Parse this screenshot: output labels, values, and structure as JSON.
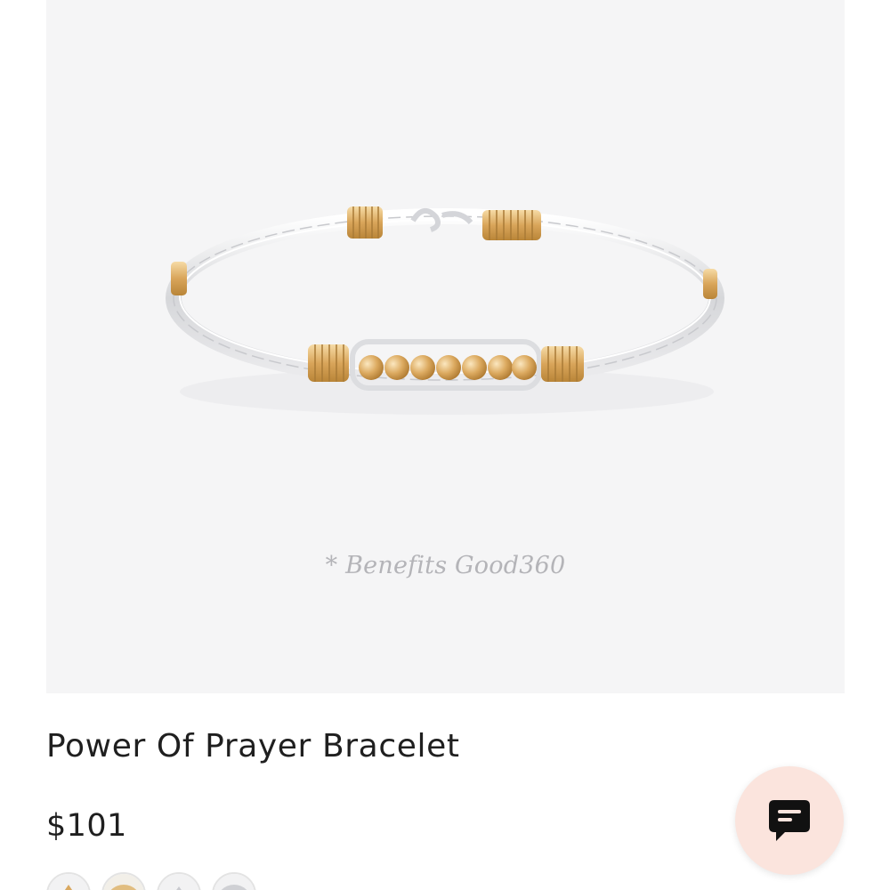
{
  "product": {
    "image_alt": "Power Of Prayer Bracelet",
    "badge": "* Benefits Good360",
    "title": "Power Of Prayer Bracelet",
    "price": "$101"
  },
  "swatches": [
    {
      "name": "gold-silver"
    },
    {
      "name": "gold"
    },
    {
      "name": "silver-gold"
    },
    {
      "name": "silver"
    }
  ],
  "chat": {
    "icon": "chat-icon",
    "background": "#fbe4dd"
  },
  "colors": {
    "image_background": "#f5f5f6",
    "gold": "#d8a85c",
    "silver": "#d9dadd",
    "text": "#1f1f1f"
  }
}
